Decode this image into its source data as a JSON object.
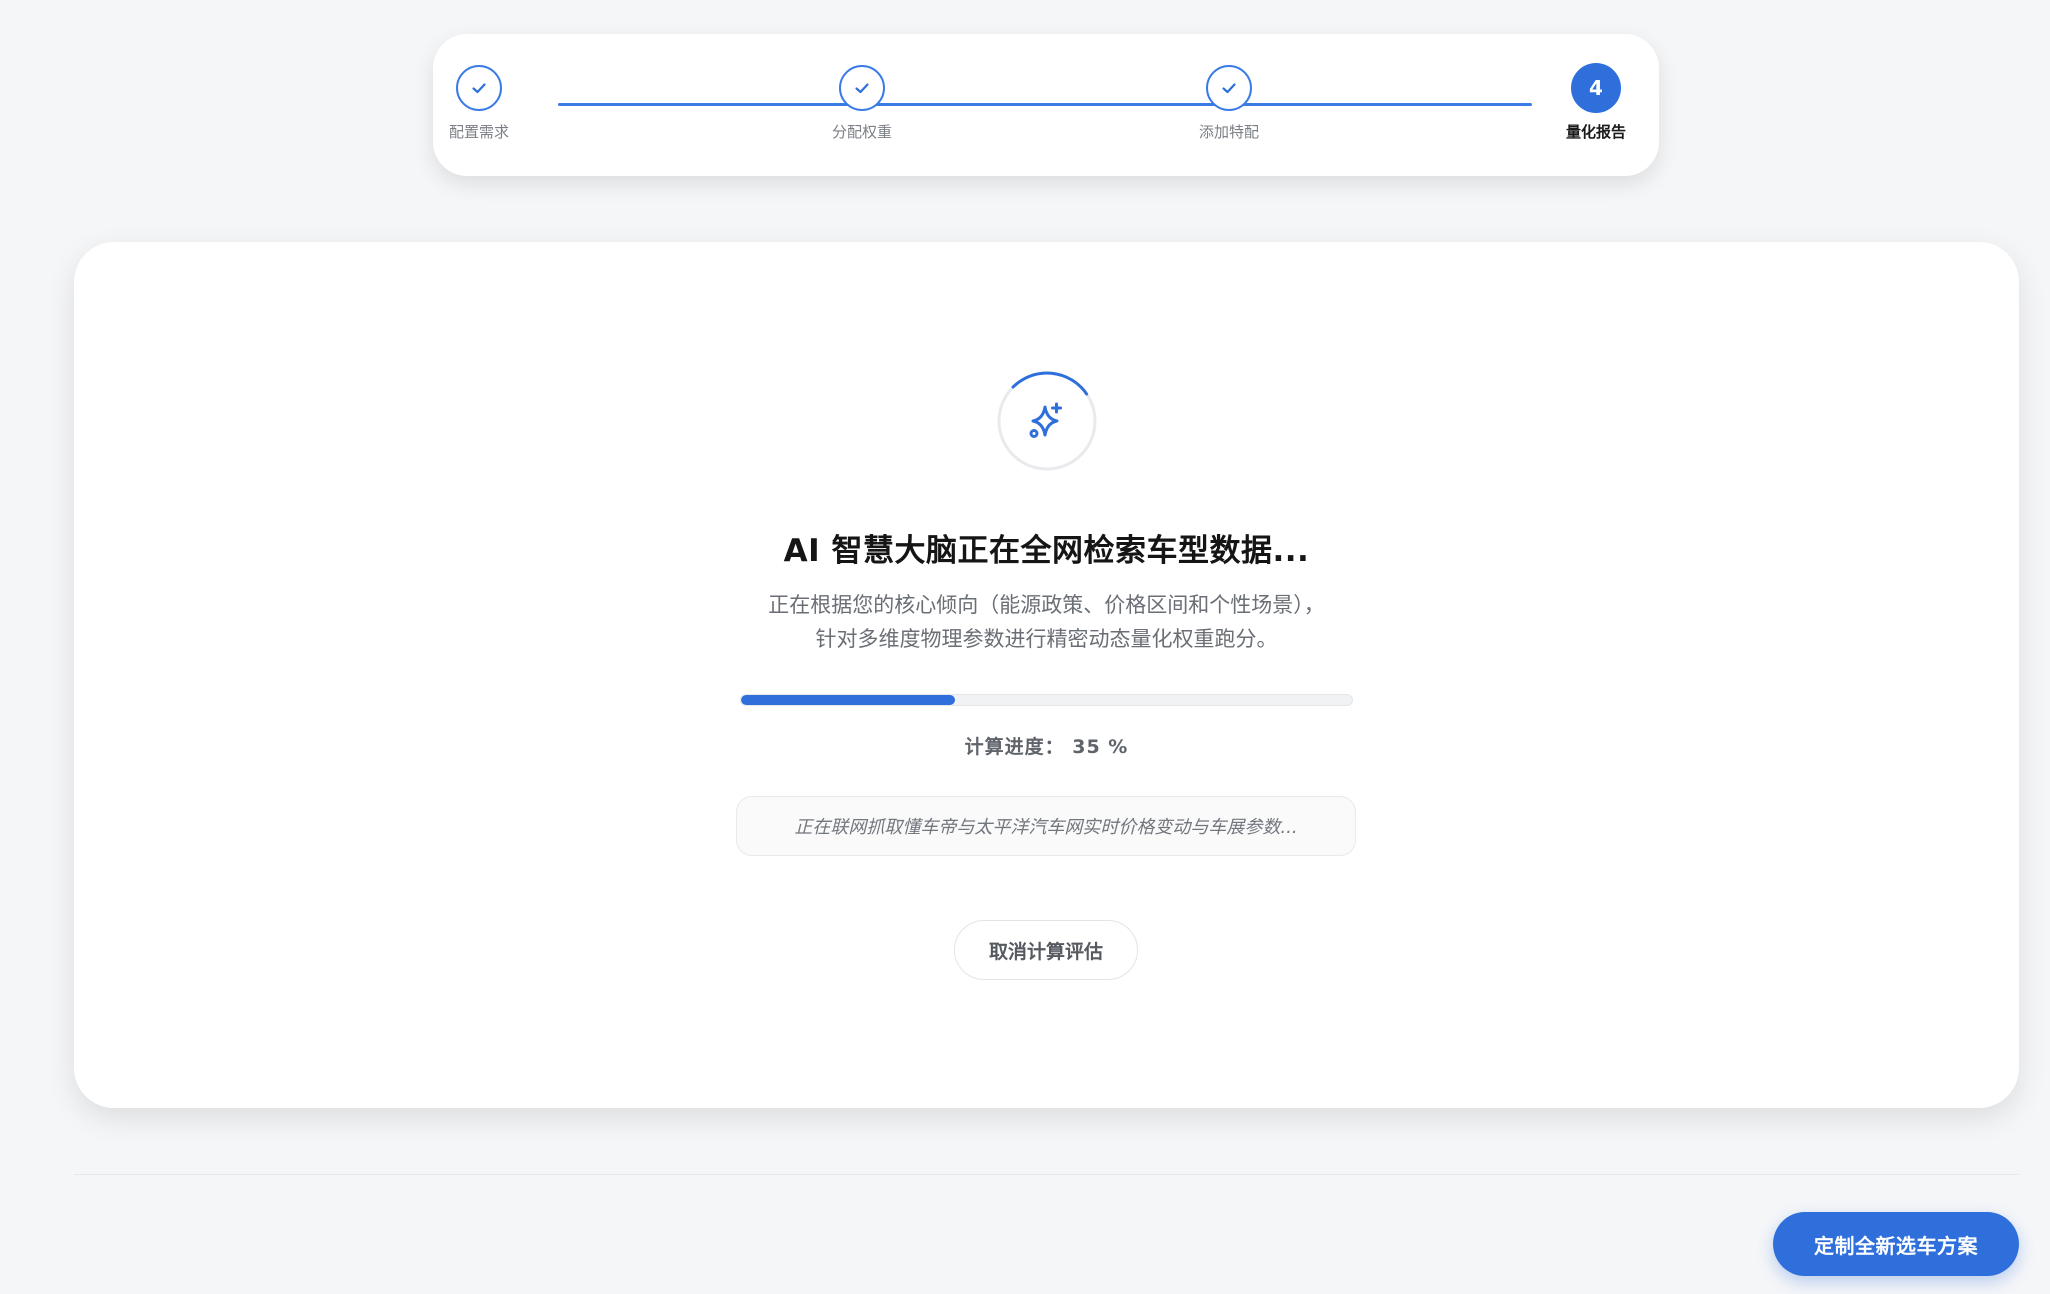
{
  "stepper": {
    "steps": [
      {
        "label": "配置需求",
        "state": "done"
      },
      {
        "label": "分配权重",
        "state": "done"
      },
      {
        "label": "添加特配",
        "state": "done"
      },
      {
        "label": "量化报告",
        "number": "4",
        "state": "active"
      }
    ]
  },
  "main": {
    "icon": "sparkles-icon",
    "title": "AI 智慧大脑正在全网检索车型数据...",
    "description_line1": "正在根据您的核心倾向（能源政策、价格区间和个性场景），",
    "description_line2": "针对多维度物理参数进行精密动态量化权重跑分。",
    "progress": {
      "percent": 35,
      "label": "计算进度： 35 %"
    },
    "log_text": "正在联网抓取懂车帝与太平洋汽车网实时价格变动与车展参数...",
    "cancel_label": "取消计算评估"
  },
  "footer": {
    "primary_label": "定制全新选车方案"
  },
  "colors": {
    "accent": "#2e6fdb",
    "background": "#f5f6f8",
    "card": "#ffffff"
  }
}
